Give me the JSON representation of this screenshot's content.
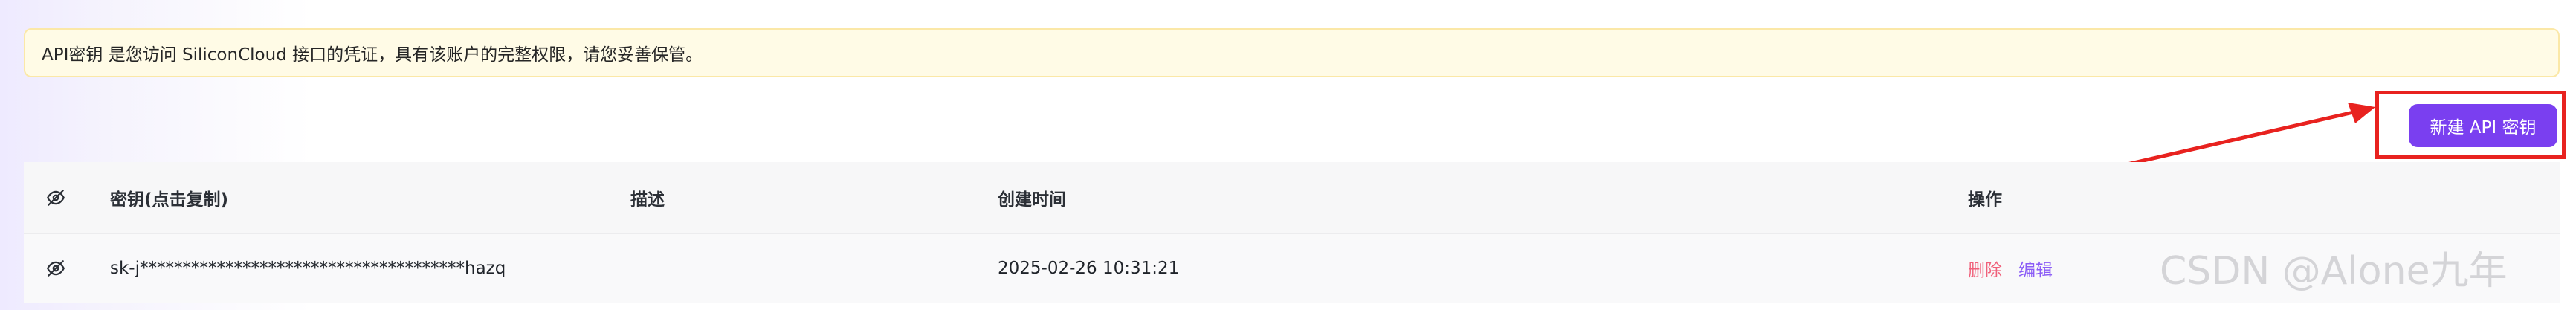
{
  "notice": {
    "text": "API密钥 是您访问 SiliconCloud 接口的凭证，具有该账户的完整权限，请您妥善保管。"
  },
  "toolbar": {
    "new_key_label": "新建 API 密钥"
  },
  "table": {
    "columns": [
      "密钥(点击复制)",
      "描述",
      "创建时间",
      "操作"
    ],
    "rows": [
      {
        "key": "sk-j**************************************hazq",
        "description": "",
        "created_at": "2025-02-26 10:31:21",
        "delete_label": "删除",
        "edit_label": "编辑"
      }
    ]
  },
  "watermark": {
    "text": "CSDN @Alone九年"
  },
  "colors": {
    "accent": "#7a3ff0",
    "annotation": "#e8221f",
    "notice_bg": "#fffbe6",
    "delete": "#f0607a",
    "edit": "#8b5cf6"
  },
  "icons": {
    "visibility_toggle": "eye-off-icon"
  }
}
